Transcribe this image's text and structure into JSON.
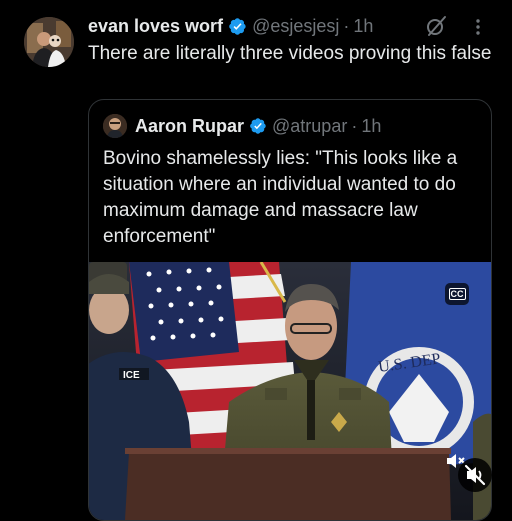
{
  "post": {
    "display_name": "evan loves worf",
    "handle": "@esjesjesj",
    "separator": "·",
    "time": "1h",
    "text": "There are literally three videos proving this false"
  },
  "quoted_post": {
    "display_name": "Aaron Rupar",
    "handle": "@atrupar",
    "separator": "·",
    "time": "1h",
    "text": "Bovino shamelessly lies: \"This looks like a situation where an individual wanted to do maximum damage and massacre law enforcement\"",
    "media": {
      "cc_label": "CC",
      "jacket_patch": "ICE",
      "seal_text": "U.S. DEP"
    }
  },
  "icons": {
    "verified": "verified-badge-icon",
    "grok": "grok-icon",
    "more": "more-options-icon",
    "cc": "closed-captions-icon",
    "mute": "muted-speaker-icon"
  },
  "colors": {
    "background": "#000000",
    "primary_text": "#e7e9ea",
    "secondary_text": "#71767b",
    "verified_blue": "#1d9bf0",
    "border": "#2f3336"
  }
}
